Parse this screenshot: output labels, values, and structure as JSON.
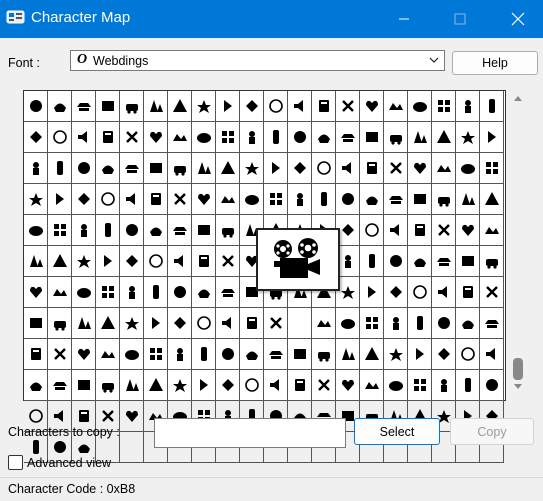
{
  "window": {
    "title": "Character Map",
    "minimize_icon": "minimize-icon",
    "maximize_icon": "maximize-icon",
    "close_icon": "close-icon"
  },
  "font": {
    "label": "Font :",
    "selected": "Webdings",
    "icon": "font-o-icon",
    "help_label": "Help"
  },
  "grid": {
    "columns": 20,
    "total_glyphs": 223,
    "selected_index": 151,
    "glyph_color": "#000000",
    "selected_glyph": "film-projector"
  },
  "copy": {
    "label": "Characters to copy :",
    "value": "",
    "select_label": "Select",
    "copy_label": "Copy"
  },
  "advanced": {
    "label": "Advanced view",
    "checked": false
  },
  "status": {
    "text": "Character Code : 0xB8"
  },
  "colors": {
    "titlebar": "#0078d7",
    "accent": "#0078d7",
    "window_bg": "#f0f0f0",
    "disabled_text": "#9a9a9a"
  }
}
